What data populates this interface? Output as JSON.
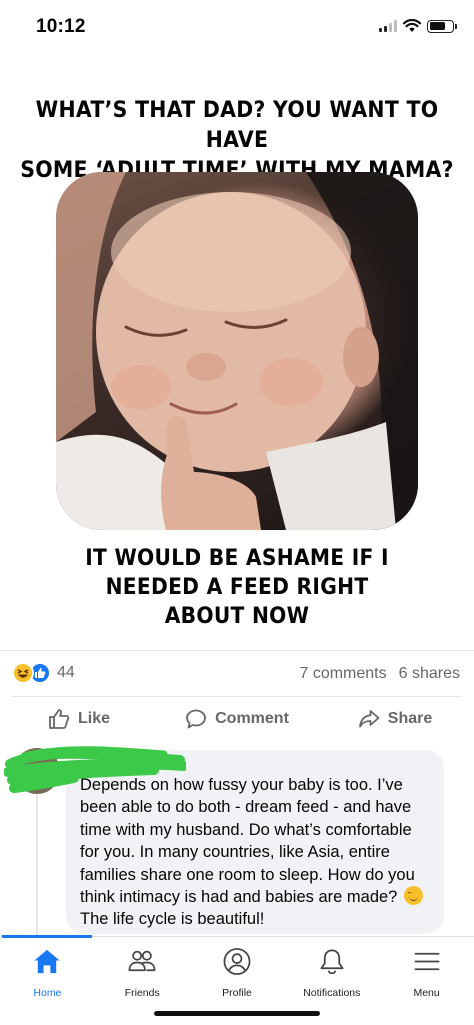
{
  "status_bar": {
    "time": "10:12"
  },
  "post": {
    "meme_top": "WHAT'S THAT DAD? YOU WANT TO HAVE SOME 'ADULT TIME' WITH MY MAMA?",
    "meme_top_line1": "WHAT’S THAT DAD? YOU WANT TO HAVE",
    "meme_top_line2": "SOME ‘ADULT TIME’ WITH MY MAMA?",
    "meme_bottom_line1": "IT WOULD BE ASHAME IF I",
    "meme_bottom_line2": "NEEDED A FEED RIGHT",
    "meme_bottom_line3": "ABOUT NOW"
  },
  "engagement": {
    "reaction_icons": [
      "haha-reaction-icon",
      "like-reaction-icon"
    ],
    "reaction_count": "44",
    "comments": "7 comments",
    "shares": "6 shares"
  },
  "actions": {
    "like": "Like",
    "comment": "Comment",
    "share": "Share"
  },
  "comment": {
    "text": "Depends on how fussy your baby is too. I’ve been able to do both - dream feed - and have time with my husband. Do what’s comfortable for you. In many countries, like Asia, entire families share one room to sleep. How do you think intimacy is had and babies are made?",
    "emoji": "smiling-face-icon",
    "text_end": "The life cycle is beautiful!"
  },
  "tabs": [
    {
      "label": "Home",
      "icon": "home-icon",
      "active": true
    },
    {
      "label": "Friends",
      "icon": "friends-icon"
    },
    {
      "label": "Profile",
      "icon": "profile-icon"
    },
    {
      "label": "Notifications",
      "icon": "bell-icon"
    },
    {
      "label": "Menu",
      "icon": "menu-icon"
    }
  ],
  "colors": {
    "accent": "#1877f2",
    "muted_text": "#65676b",
    "bubble": "#f0f2f5",
    "redaction": "#3cc94a"
  }
}
